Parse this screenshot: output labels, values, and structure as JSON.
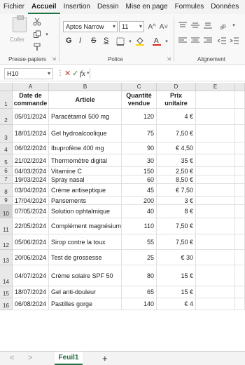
{
  "menu": {
    "tabs": [
      "Fichier",
      "Accueil",
      "Insertion",
      "Dessin",
      "Mise en page",
      "Formules",
      "Données"
    ],
    "active": "Accueil"
  },
  "ribbon": {
    "paste_label": "Coller",
    "clipboard_label": "Presse-papiers",
    "font_label": "Police",
    "align_label": "Alignement",
    "font_name": "Aptos Narrow",
    "font_size": "11",
    "grow_font": "A^",
    "shrink_font": "A˅",
    "bold": "G",
    "italic": "I",
    "strike": "S",
    "underline": "S"
  },
  "formula_bar": {
    "name_box": "H10",
    "cancel": "✕",
    "enter": "✓",
    "fx": "fx",
    "value": ""
  },
  "grid": {
    "columns": [
      "A",
      "B",
      "C",
      "D",
      "E"
    ],
    "headers": {
      "a": "Date de commande",
      "b": "Article",
      "c": "Quantité vendue",
      "d": "Prix unitaire"
    },
    "selected_row": "10",
    "rows": [
      {
        "num": "1"
      },
      {
        "num": "2",
        "date": "05/01/2024",
        "item": "Paracétamol 500 mg",
        "qty": "120",
        "price": "4 €"
      },
      {
        "num": "3",
        "date": "18/01/2024",
        "item": "Gel hydroalcoolique",
        "qty": "75",
        "price": "7,50 €"
      },
      {
        "num": "4",
        "date": "06/02/2024",
        "item": "Ibuprofène 400 mg",
        "qty": "90",
        "price": "€ 4,50"
      },
      {
        "num": "5",
        "date": "21/02/2024",
        "item": "Thermomètre digital",
        "qty": "30",
        "price": "35 €"
      },
      {
        "num": "6",
        "date": "04/03/2024",
        "item": "Vitamine C",
        "qty": "150",
        "price": "2,50 €"
      },
      {
        "num": "7",
        "date": "19/03/2024",
        "item": "Spray nasal",
        "qty": "60",
        "price": "8,50 €"
      },
      {
        "num": "8",
        "date": "03/04/2024",
        "item": "Crème antiseptique",
        "qty": "45",
        "price": "€ 7,50"
      },
      {
        "num": "9",
        "date": "17/04/2024",
        "item": "Pansements",
        "qty": "200",
        "price": "3 €"
      },
      {
        "num": "10",
        "date": "07/05/2024",
        "item": "Solution ophtalmique",
        "qty": "40",
        "price": "8 €"
      },
      {
        "num": "11",
        "date": "22/05/2024",
        "item": "Complément magnésium",
        "qty": "110",
        "price": "7,50 €"
      },
      {
        "num": "12",
        "date": "05/06/2024",
        "item": "Sirop contre la toux",
        "qty": "55",
        "price": "7,50 €"
      },
      {
        "num": "13",
        "date": "20/06/2024",
        "item": "Test de grossesse",
        "qty": "25",
        "price": "€ 30"
      },
      {
        "num": "14",
        "date": "04/07/2024",
        "item": "Crème solaire SPF 50",
        "qty": "80",
        "price": "15 €"
      },
      {
        "num": "15",
        "date": "18/07/2024",
        "item": "Gel anti-douleur",
        "qty": "65",
        "price": "15 €"
      },
      {
        "num": "16",
        "date": "06/08/2024",
        "item": "Pastilles gorge",
        "qty": "140",
        "price": "€ 4"
      }
    ]
  },
  "sheets": {
    "prev": "<",
    "next": ">",
    "active": "Feuil1",
    "add": "+"
  },
  "colors": {
    "accent": "#217346"
  }
}
